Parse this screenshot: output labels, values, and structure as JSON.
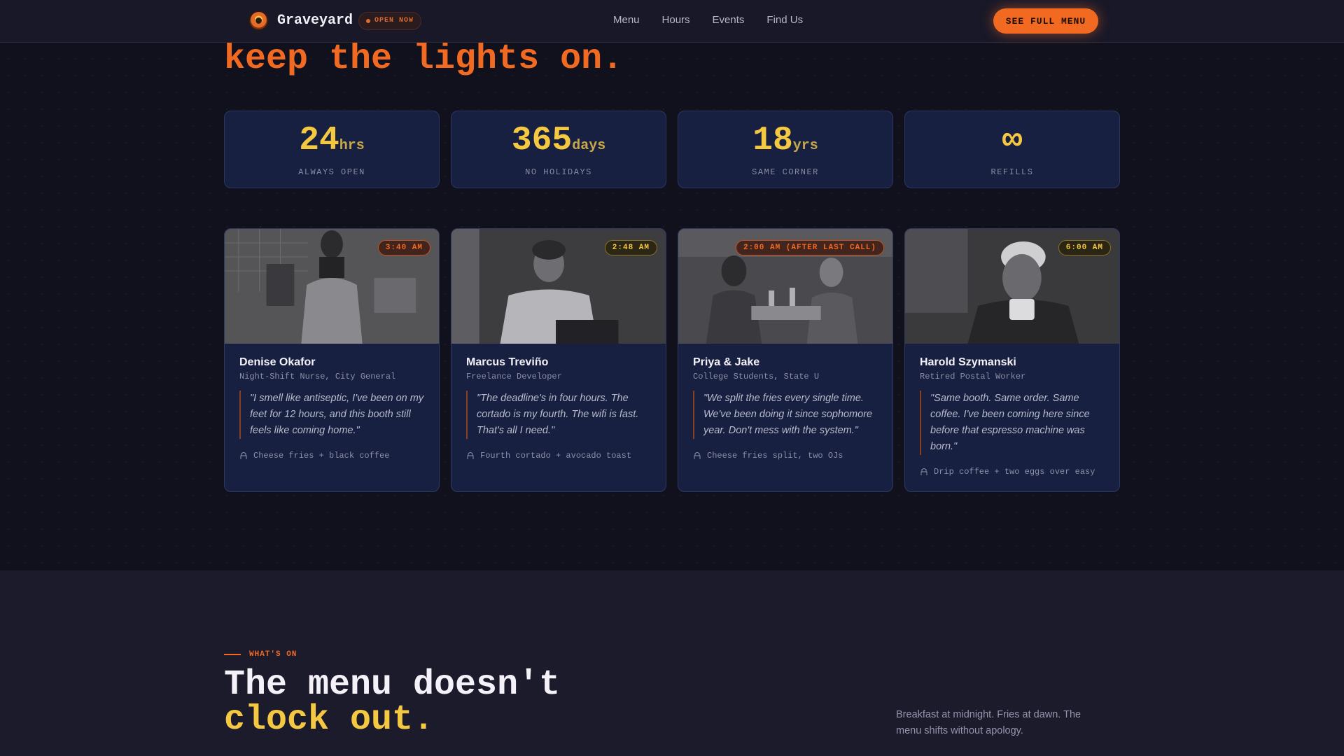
{
  "nav": {
    "brand": "Graveyard",
    "status_badge": "OPEN NOW",
    "links": [
      "Menu",
      "Hours",
      "Events",
      "Find Us"
    ],
    "cta": "SEE FULL MENU"
  },
  "hero": {
    "tail_line": "keep the lights on."
  },
  "stats": [
    {
      "value": "24",
      "unit": "hrs",
      "label": "ALWAYS OPEN"
    },
    {
      "value": "365",
      "unit": "days",
      "label": "NO HOLIDAYS"
    },
    {
      "value": "18",
      "unit": "yrs",
      "label": "SAME CORNER"
    },
    {
      "value": "∞",
      "unit": "",
      "label": "REFILLS"
    }
  ],
  "regulars": [
    {
      "time": "3:40 AM",
      "name": "Denise Okafor",
      "role": "Night-Shift Nurse, City General",
      "quote": "\"I smell like antiseptic, I've been on my feet for 12 hours, and this booth still feels like coming home.\"",
      "order": "Cheese fries + black coffee"
    },
    {
      "time": "2:48 AM",
      "name": "Marcus Treviño",
      "role": "Freelance Developer",
      "quote": "\"The deadline's in four hours. The cortado is my fourth. The wifi is fast. That's all I need.\"",
      "order": "Fourth cortado + avocado toast"
    },
    {
      "time": "2:00 AM (AFTER LAST CALL)",
      "name": "Priya & Jake",
      "role": "College Students, State U",
      "quote": "\"We split the fries every single time. We've been doing it since sophomore year. Don't mess with the system.\"",
      "order": "Cheese fries split, two OJs"
    },
    {
      "time": "6:00 AM",
      "name": "Harold Szymanski",
      "role": "Retired Postal Worker",
      "quote": "\"Same booth. Same order. Same coffee. I've been coming here since before that espresso machine was born.\"",
      "order": "Drip coffee + two eggs over easy"
    }
  ],
  "menu_section": {
    "eyebrow": "WHAT'S ON",
    "title_line1": "The menu doesn't",
    "title_line2": "clock out.",
    "description": "Breakfast at midnight. Fries at dawn. The menu shifts without apology."
  },
  "colors": {
    "accent_orange": "#f26a21",
    "accent_yellow": "#f5c842",
    "card_bg": "#172040",
    "page_bg": "#11111d"
  },
  "icons": {
    "logo": "diner-logo-icon",
    "order": "utensils-icon"
  }
}
